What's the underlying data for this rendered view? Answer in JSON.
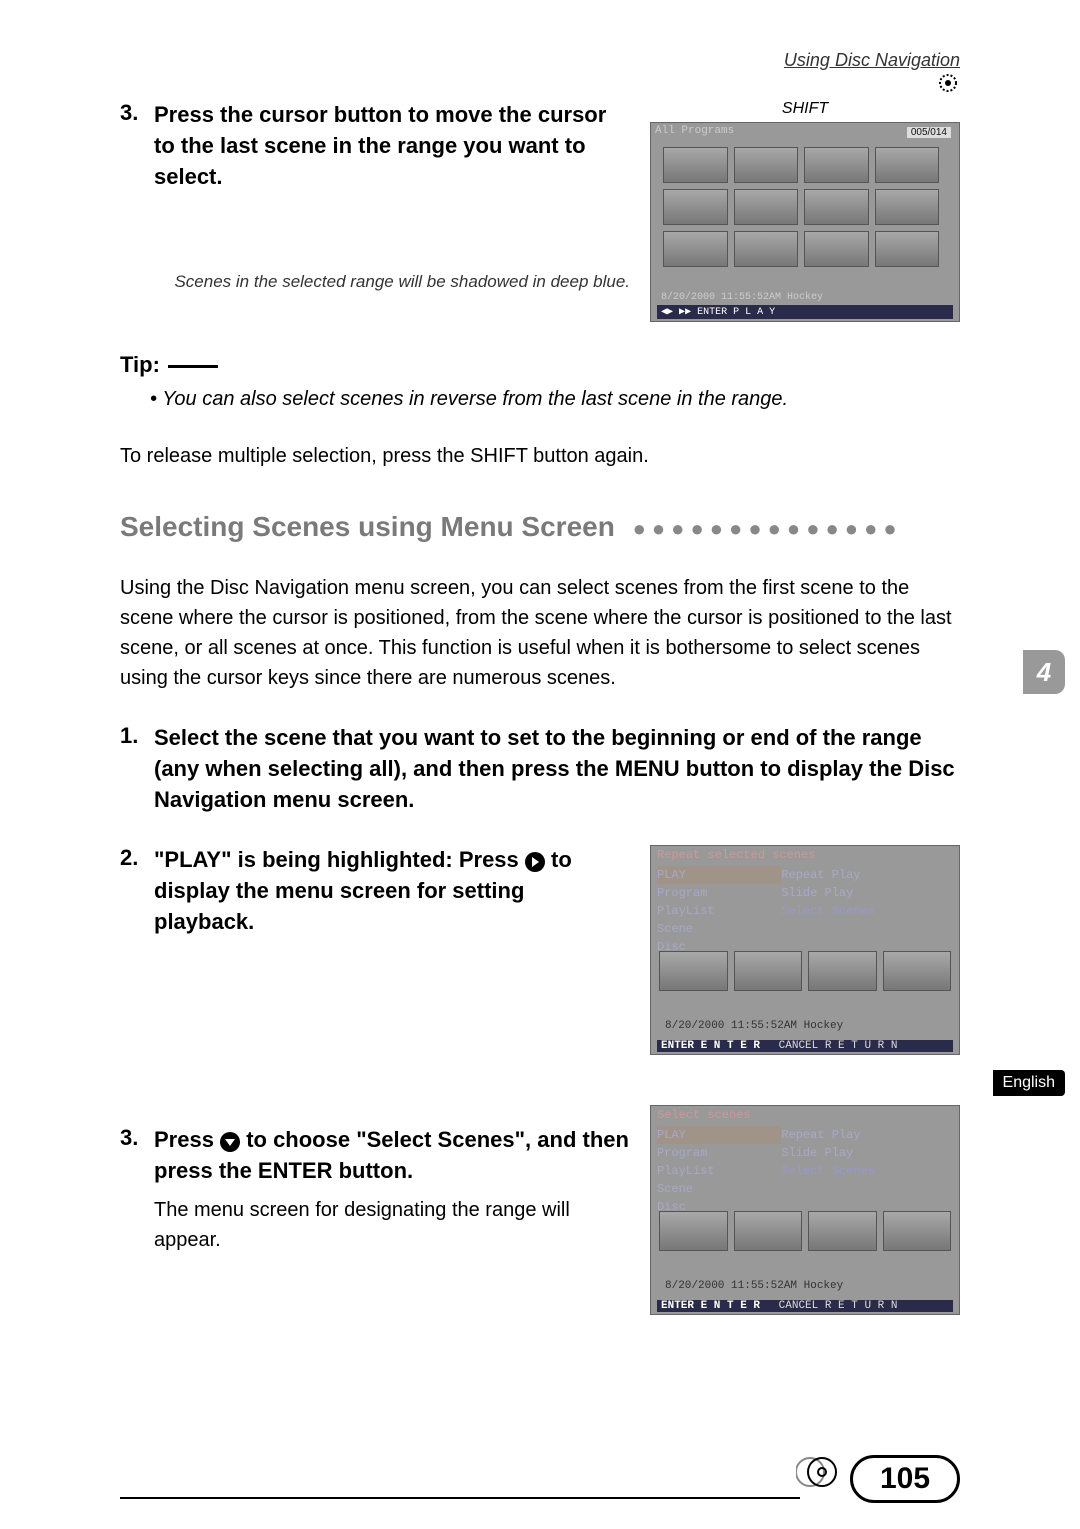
{
  "header": {
    "breadcrumb": "Using Disc Navigation"
  },
  "step3a": {
    "num": "3.",
    "text": "Press the cursor button to move the cursor to the last scene in the range you want to select."
  },
  "shift_caption": "SHIFT",
  "range_caption": "Scenes in the selected range will be shadowed in deep blue.",
  "tip": {
    "label": "Tip:",
    "bullet": "• You can also select scenes in reverse from the last scene in the range."
  },
  "release_para": "To release multiple selection, press the SHIFT button again.",
  "section_title": "Selecting Scenes using Menu Screen",
  "dots": "●●●●●●●●●●●●●●",
  "intro_para": "Using the Disc Navigation menu screen, you can select scenes from the first scene to the scene where the cursor is positioned, from the scene where the cursor is positioned to the last scene, or all scenes at once. This function is useful when it is bothersome to select scenes using the cursor keys since there are numerous scenes.",
  "step1": {
    "num": "1.",
    "text": "Select the scene that you want to set to the beginning or end of the range (any when selecting all), and then press the MENU button to display the Disc Navigation menu screen."
  },
  "step2": {
    "num": "2.",
    "pre": "\"PLAY\" is being highlighted: Press ",
    "post": " to display the menu screen for setting playback."
  },
  "step3b": {
    "num": "3.",
    "pre": "Press ",
    "post": " to choose \"Select Scenes\", and then press the ENTER button.",
    "sub": "The menu screen for designating the range will appear."
  },
  "side_tab": "4",
  "side_english": "English",
  "page_num": "105",
  "screenshot1": {
    "title": "All Programs",
    "counter": "005/014",
    "status": "8/20/2000 11:55:52AM   Hockey",
    "footer": "◀▶ ▶▶ ENTER P L A Y"
  },
  "screenshot2": {
    "title": "Repeat selected scenes",
    "left": [
      "PLAY",
      "Program",
      "PlayList",
      "Scene",
      "Disc"
    ],
    "right": [
      "Repeat Play",
      "Slide Play",
      "Select Scenes"
    ],
    "status": "8/20/2000 11:55:52AM   Hockey",
    "footer_enter": "ENTER E N T E R",
    "footer_cancel": "CANCEL R E T U R N"
  },
  "screenshot3": {
    "title": "Select scenes",
    "left": [
      "PLAY",
      "Program",
      "PlayList",
      "Scene",
      "Disc"
    ],
    "right": [
      "Repeat Play",
      "Slide Play",
      "Select Scenes"
    ],
    "status": "8/20/2000 11:55:52AM   Hockey",
    "footer_enter": "ENTER E N T E R",
    "footer_cancel": "CANCEL R E T U R N"
  }
}
